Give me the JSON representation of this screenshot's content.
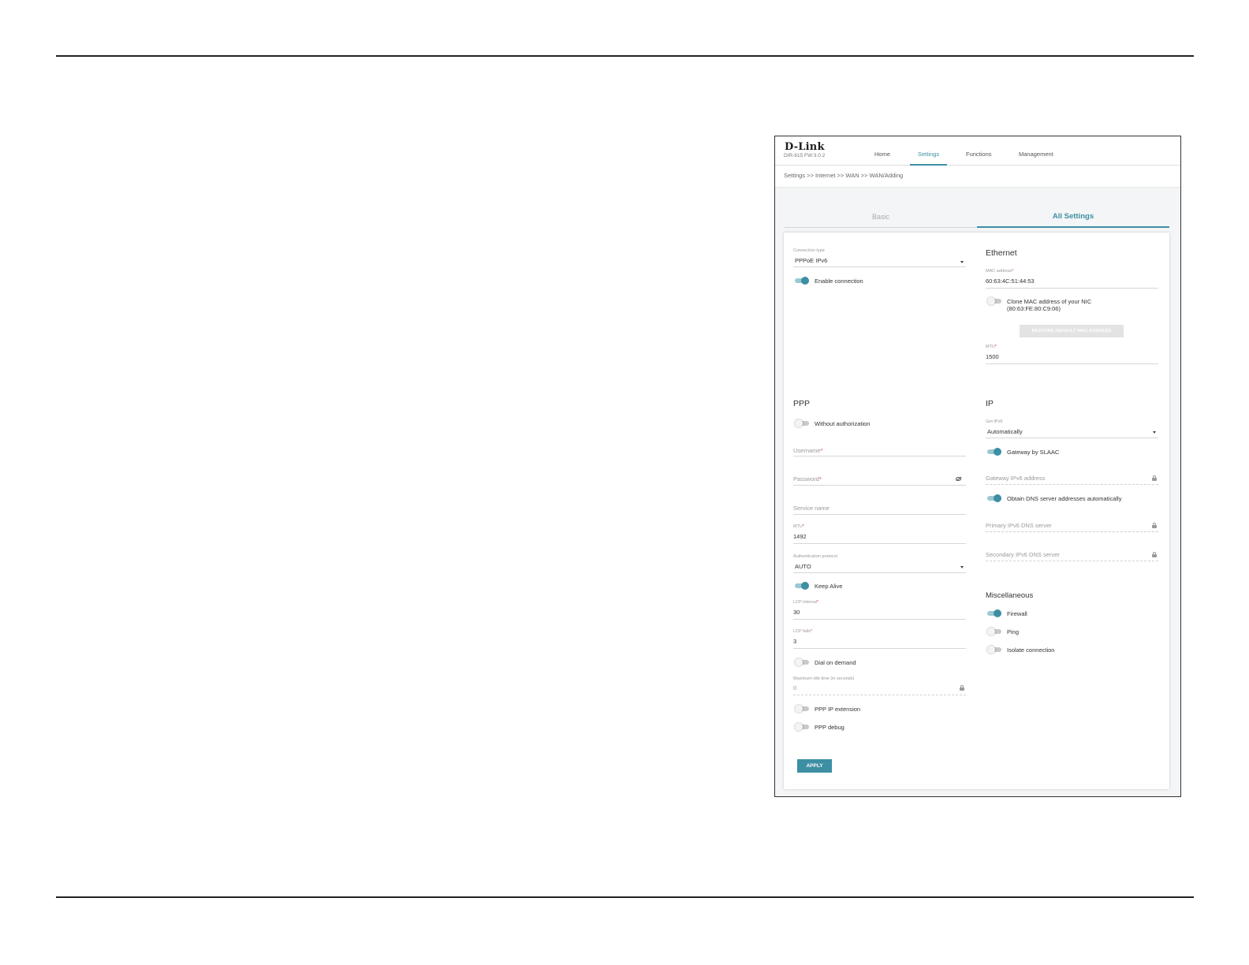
{
  "header": {
    "logo": "D-Link",
    "model_fw": "DIR-615 FW:3.0.2",
    "nav": [
      {
        "label": "Home",
        "active": false
      },
      {
        "label": "Settings",
        "active": true
      },
      {
        "label": "Functions",
        "active": false
      },
      {
        "label": "Management",
        "active": false
      }
    ]
  },
  "breadcrumb": "Settings >> Internet >> WAN >> WAN/Adding",
  "tabs": {
    "basic": "Basic",
    "all": "All Settings"
  },
  "left": {
    "connection_type": {
      "label": "Connection type",
      "value": "PPPoE IPv6"
    },
    "enable_connection": {
      "label": "Enable connection",
      "on": true
    },
    "ppp": {
      "title": "PPP",
      "without_auth": {
        "label": "Without authorization",
        "on": false
      },
      "username_placeholder": "Username",
      "password_placeholder": "Password",
      "service_name_placeholder": "Service name",
      "mtu": {
        "label": "MTU",
        "value": "1492"
      },
      "auth_protocol": {
        "label": "Authentication protocol",
        "value": "AUTO"
      },
      "keep_alive": {
        "label": "Keep Alive",
        "on": true
      },
      "lcp_interval": {
        "label": "LCP interval",
        "value": "30"
      },
      "lcp_fails": {
        "label": "LCP fails",
        "value": "3"
      },
      "dial_on_demand": {
        "label": "Dial on demand",
        "on": false
      },
      "max_idle": {
        "label": "Maximum idle time (in seconds)",
        "value": "0"
      },
      "ppp_ip_extension": {
        "label": "PPP IP extension",
        "on": false
      },
      "ppp_debug": {
        "label": "PPP debug",
        "on": false
      }
    },
    "apply_label": "APPLY"
  },
  "right": {
    "ethernet": {
      "title": "Ethernet",
      "mac": {
        "label": "MAC address",
        "value": "60:63:4C:51:44:53"
      },
      "clone_mac": {
        "label_line1": "Clone MAC address of your NIC",
        "label_line2": "(80:63:FE:80:C9:06)",
        "on": false
      },
      "restore_label": "RESTORE DEFAULT MAC ADDRESS",
      "mtu": {
        "label": "MTU",
        "value": "1500"
      }
    },
    "ip": {
      "title": "IP",
      "get_ipv6": {
        "label": "Get IPv6",
        "value": "Automatically"
      },
      "gateway_slaac": {
        "label": "Gateway by SLAAC",
        "on": true
      },
      "gateway_ipv6_placeholder": "Gateway IPv6 address",
      "obtain_dns": {
        "label": "Obtain DNS server addresses automatically",
        "on": true
      },
      "primary_dns_placeholder": "Primary IPv6 DNS server",
      "secondary_dns_placeholder": "Secondary IPv6 DNS server"
    },
    "misc": {
      "title": "Miscellaneous",
      "firewall": {
        "label": "Firewall",
        "on": true
      },
      "ping": {
        "label": "Ping",
        "on": false
      },
      "isolate": {
        "label": "Isolate connection",
        "on": false
      }
    }
  },
  "required_mark": "*",
  "colors": {
    "accent": "#3d8fa3",
    "required": "#e0464c"
  }
}
